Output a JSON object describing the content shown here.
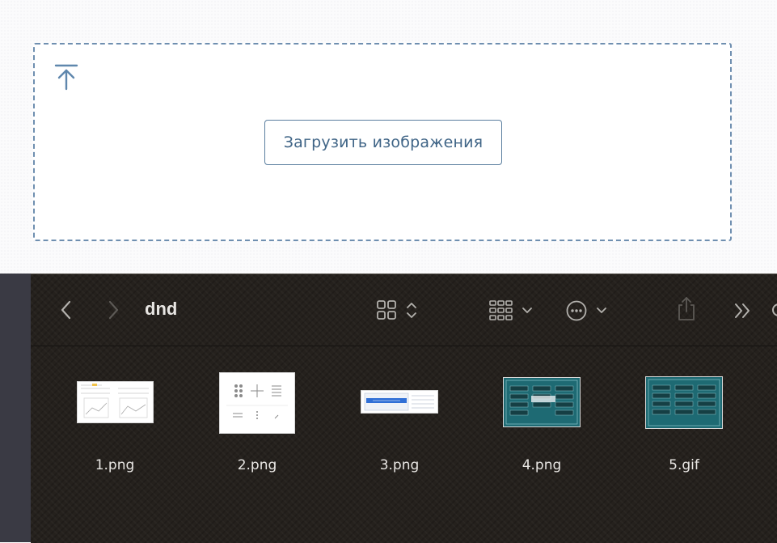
{
  "upload": {
    "button_label": "Загрузить изображения",
    "icon": "upload-arrow-icon",
    "accent_color": "#5a7e9f"
  },
  "finder": {
    "folder_title": "dnd",
    "toolbar": {
      "back_icon": "chevron-left-icon",
      "forward_icon": "chevron-right-icon",
      "view_icon": "grid-view-icon",
      "group_icon": "group-by-icon",
      "action_icon": "more-actions-icon",
      "share_icon": "share-icon",
      "overflow_icon": "double-chevron-icon"
    },
    "files": [
      {
        "name": "1.png",
        "icon": "image-thumbnail"
      },
      {
        "name": "2.png",
        "icon": "image-thumbnail"
      },
      {
        "name": "3.png",
        "icon": "image-thumbnail"
      },
      {
        "name": "4.png",
        "icon": "image-thumbnail"
      },
      {
        "name": "5.gif",
        "icon": "image-thumbnail"
      }
    ]
  }
}
